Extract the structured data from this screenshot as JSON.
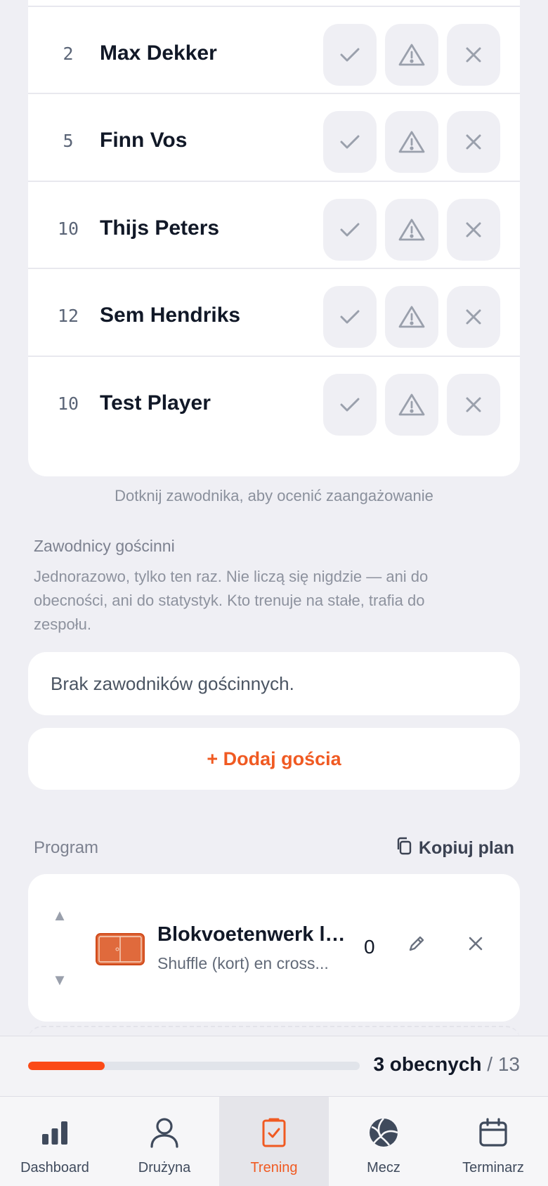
{
  "players": [
    {
      "number": "2",
      "name": "Max Dekker"
    },
    {
      "number": "5",
      "name": "Finn Vos"
    },
    {
      "number": "10",
      "name": "Thijs Peters"
    },
    {
      "number": "12",
      "name": "Sem Hendriks"
    },
    {
      "number": "10",
      "name": "Test Player"
    }
  ],
  "status_icons": {
    "present": "check-icon",
    "injured": "warning-icon",
    "absent": "close-icon"
  },
  "hint": "Dotknij zawodnika, aby ocenić zaangażowanie",
  "guests": {
    "title": "Zawodnicy gościnni",
    "description": "Jednorazowo, tylko ten raz. Nie liczą się nigdzie — ani do obecności, ani do statystyk. Kto trenuje na stałe, trafia do zespołu.",
    "empty": "Brak zawodników gościnnych.",
    "add_label": "+ Dodaj gościa"
  },
  "program": {
    "label": "Program",
    "copy_label": "Kopiuj plan",
    "drills": [
      {
        "title": "Blokvoetenwerk la...",
        "subtitle": "Shuffle (kort) en cross...",
        "count": "0"
      }
    ]
  },
  "attendance": {
    "present_text": "3 obecnych",
    "separator": " / ",
    "total": "13",
    "fraction": 0.23
  },
  "tabs": [
    {
      "label": "Dashboard",
      "icon": "bar-chart-icon"
    },
    {
      "label": "Drużyna",
      "icon": "user-icon"
    },
    {
      "label": "Trening",
      "icon": "checkbox-clipboard-icon",
      "active": true
    },
    {
      "label": "Mecz",
      "icon": "volleyball-icon"
    },
    {
      "label": "Terminarz",
      "icon": "calendar-icon"
    }
  ],
  "colors": {
    "accent": "#f05a22",
    "progress": "#fb4a16",
    "background": "#efeff4"
  }
}
